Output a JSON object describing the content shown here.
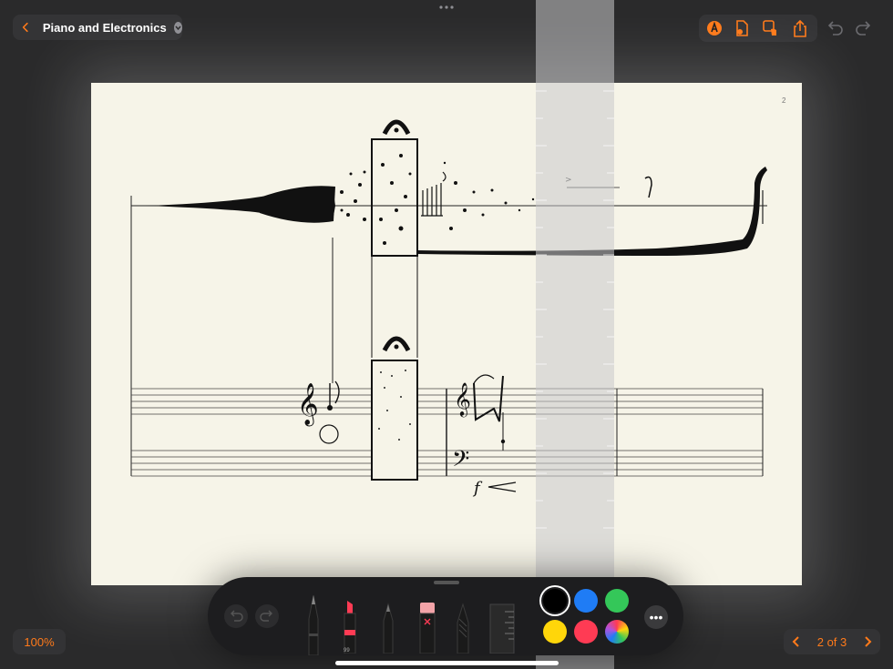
{
  "header": {
    "title": "Piano and Electronics",
    "back_icon": "chevron-left-icon",
    "title_menu_icon": "chevron-down-icon",
    "tools": [
      "annotate-icon",
      "page-settings-icon",
      "hand-touch-icon",
      "share-icon"
    ],
    "undo_icon": "undo-icon",
    "redo_icon": "redo-icon"
  },
  "score": {
    "page_number": "2",
    "dynamics": "f"
  },
  "palette": {
    "tools": [
      "pencil",
      "marker",
      "pen",
      "eraser",
      "lasso",
      "ruler"
    ],
    "marker_label": "99",
    "colors": [
      "#000000",
      "#1f7cf5",
      "#34c759",
      "#ffd60a",
      "#ff3b54",
      "rainbow"
    ],
    "selected_color": "#000000",
    "more_icon": "ellipsis-icon",
    "more_label": "•••"
  },
  "footer": {
    "zoom": "100%",
    "page_indicator": "2 of 3"
  },
  "colors": {
    "accent": "#ff7a1a",
    "page": "#f6f4e8",
    "chrome": "#2a2a2b"
  }
}
